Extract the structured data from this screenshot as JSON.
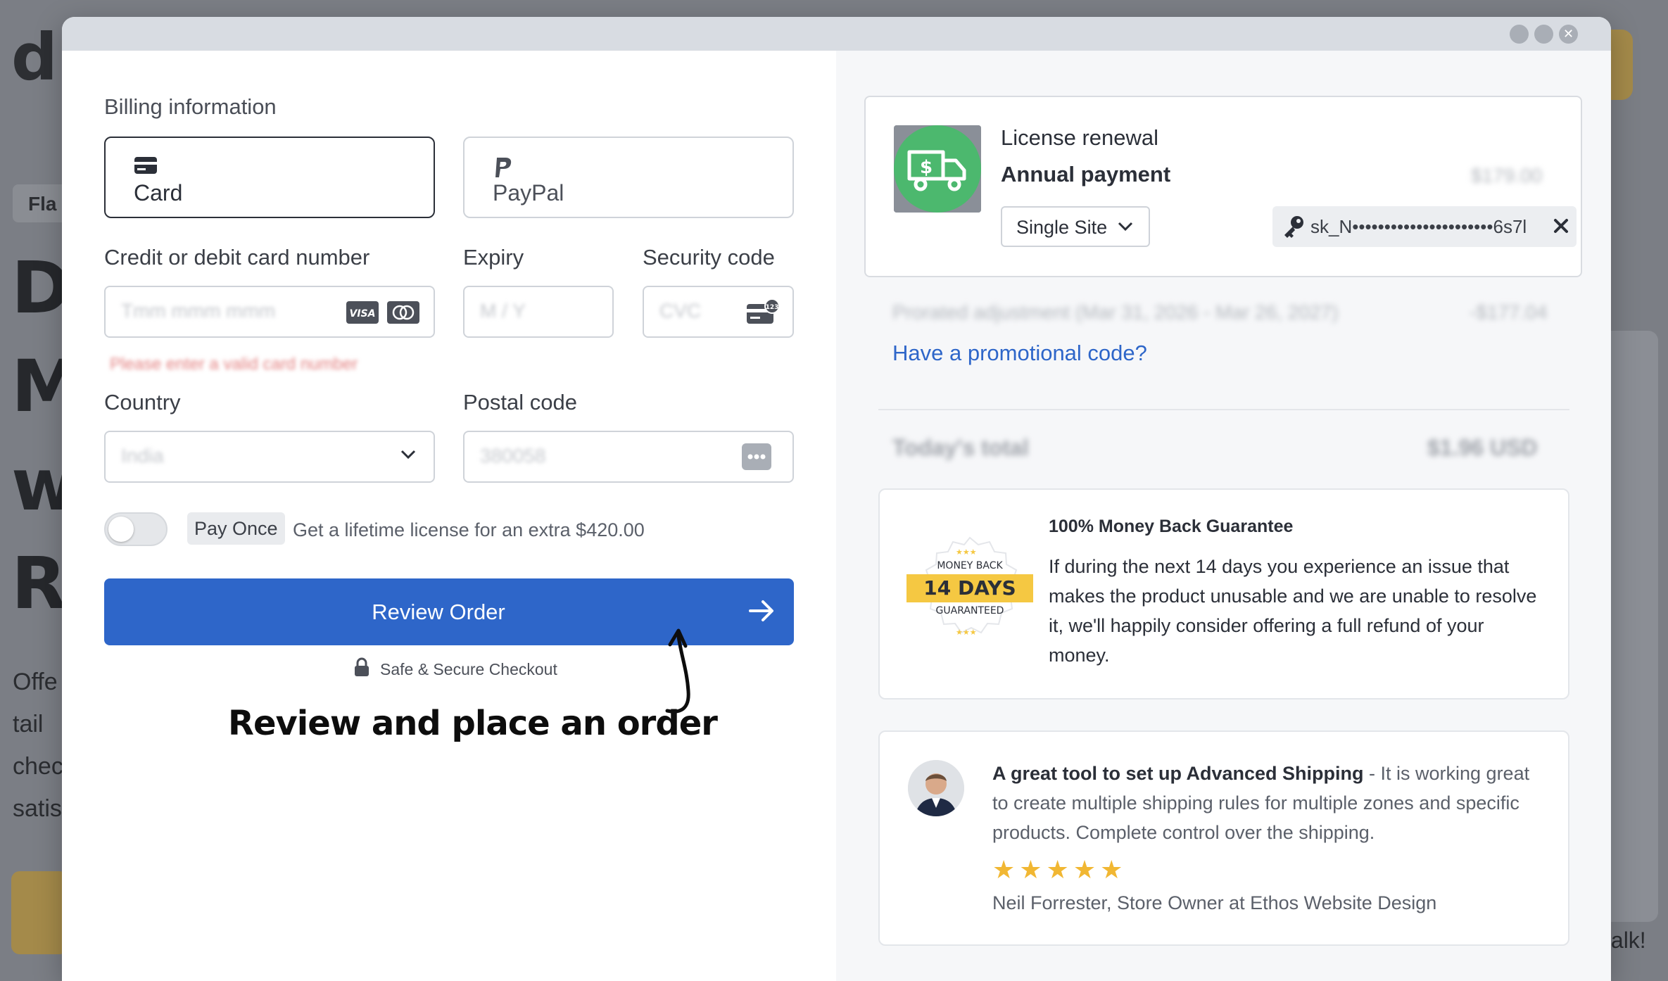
{
  "background": {
    "logo": "d",
    "chip": "Fla",
    "heading_letters": [
      "D",
      "M",
      "w",
      "R"
    ],
    "paragraph_lines": [
      "Offe",
      "tail",
      "chec",
      "satis"
    ],
    "chat_text": "talk!"
  },
  "billing": {
    "section_title": "Billing information",
    "methods": [
      {
        "label": "Card",
        "icon": "credit-card-icon",
        "selected": true
      },
      {
        "label": "PayPal",
        "icon": "paypal-icon",
        "selected": false
      }
    ],
    "card_number_label": "Credit or debit card number",
    "card_number_placeholder": "Tmm mmm mmm",
    "card_error": "Please enter a valid card number",
    "expiry_label": "Expiry",
    "expiry_placeholder": "M / Y",
    "security_label": "Security code",
    "security_placeholder": "CVC",
    "country_label": "Country",
    "country_value": "India",
    "postal_label": "Postal code",
    "postal_placeholder": "380058",
    "pay_once_tag": "Pay Once",
    "lifetime_text": "Get a lifetime license for an extra $420.00",
    "review_button": "Review Order",
    "secure_text": "Safe & Secure Checkout",
    "annotation": "Review and place an order"
  },
  "order": {
    "product_title": "License renewal",
    "product_subtitle": "Annual payment",
    "price": "$179.00",
    "site_option": "Single Site",
    "license_key": "sk_N••••••••••••••••••••••6s7l",
    "prorated_label": "Prorated adjustment (Mar 31, 2026 - Mar 26, 2027)",
    "prorated_value": "-$177.04",
    "promo_link": "Have a promotional code?",
    "total_label": "Today's total",
    "total_value": "$1.96 USD"
  },
  "guarantee": {
    "badge_top": "MONEY BACK",
    "badge_days": "14 DAYS",
    "badge_bottom": "GUARANTEED",
    "title": "100% Money Back Guarantee",
    "body": "If during the next 14 days you experience an issue that makes the product unusable and we are unable to resolve it, we'll happily consider offering a full refund of your money."
  },
  "testimonial": {
    "headline": "A great tool to set up Advanced Shipping",
    "body": " - It is working great to create multiple shipping rules for multiple zones and specific products. Complete control over the shipping.",
    "rating": 5,
    "stars": "★★★★★",
    "author": "Neil Forrester, Store Owner at Ethos Website Design"
  },
  "colors": {
    "primary": "#2e66c9",
    "star": "#f1b733",
    "badge_gold": "#f5c842",
    "product_green": "#4cb86e"
  }
}
